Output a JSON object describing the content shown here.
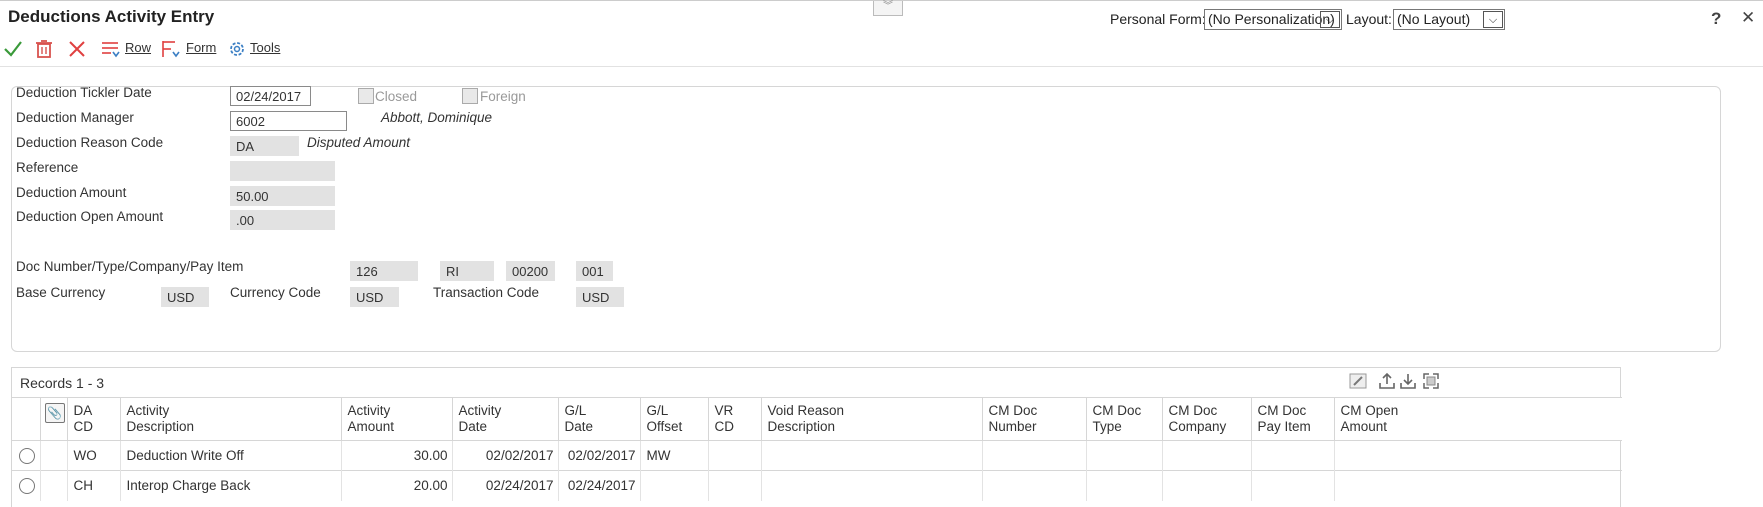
{
  "window": {
    "title": "Deductions Activity Entry",
    "personal_form_label": "Personal Form:",
    "personal_form_value": "(No Personalization)",
    "layout_label": "Layout:",
    "layout_value": "(No Layout)",
    "help_glyph": "?",
    "close_glyph": "✕"
  },
  "toolbar": {
    "row_label": "Row",
    "form_label": "Form",
    "tools_label": "Tools"
  },
  "form": {
    "tickler_date_label": "Deduction Tickler Date",
    "tickler_date_value": "02/24/2017",
    "closed_label": "Closed",
    "foreign_label": "Foreign",
    "manager_label": "Deduction Manager",
    "manager_value": "6002",
    "manager_name": "Abbott, Dominique",
    "reason_code_label": "Deduction Reason Code",
    "reason_code_value": "DA",
    "reason_code_desc": "Disputed Amount",
    "reference_label": "Reference",
    "reference_value": "",
    "amount_label": "Deduction Amount",
    "amount_value": "50.00",
    "open_amount_label": "Deduction Open Amount",
    "open_amount_value": ".00",
    "doc_label": "Doc Number/Type/Company/Pay Item",
    "doc_number": "126",
    "doc_type": "RI",
    "doc_company": "00200",
    "doc_pay_item": "001",
    "base_currency_label": "Base Currency",
    "base_currency_value": "USD",
    "currency_code_label": "Currency Code",
    "currency_code_value": "USD",
    "transaction_code_label": "Transaction Code",
    "transaction_code_value": "USD"
  },
  "grid": {
    "records_label": "Records 1 - 3",
    "headers": {
      "da_cd_1": "DA",
      "da_cd_2": "CD",
      "act_desc_1": "Activity",
      "act_desc_2": "Description",
      "act_amt_1": "Activity",
      "act_amt_2": "Amount",
      "act_date_1": "Activity",
      "act_date_2": "Date",
      "gl_date_1": "G/L",
      "gl_date_2": "Date",
      "gl_offset_1": "G/L",
      "gl_offset_2": "Offset",
      "vr_cd_1": "VR",
      "vr_cd_2": "CD",
      "void_desc_1": "Void Reason",
      "void_desc_2": "Description",
      "cm_num_1": "CM Doc",
      "cm_num_2": "Number",
      "cm_type_1": "CM Doc",
      "cm_type_2": "Type",
      "cm_co_1": "CM Doc",
      "cm_co_2": "Company",
      "cm_pay_1": "CM Doc",
      "cm_pay_2": "Pay Item",
      "cm_open_1": "CM Open",
      "cm_open_2": "Amount"
    },
    "rows": [
      {
        "da_cd": "WO",
        "activity_description": "Deduction Write Off",
        "activity_amount": "30.00",
        "activity_date": "02/02/2017",
        "gl_date": "02/02/2017",
        "gl_offset": "MW"
      },
      {
        "da_cd": "CH",
        "activity_description": "Interop Charge Back",
        "activity_amount": "20.00",
        "activity_date": "02/24/2017",
        "gl_date": "02/24/2017",
        "gl_offset": ""
      }
    ]
  },
  "colors": {
    "ok_green": "#3a9a3a",
    "delete_red": "#d9534f",
    "cancel_red": "#e04040",
    "tools_blue": "#3b7fc4"
  }
}
